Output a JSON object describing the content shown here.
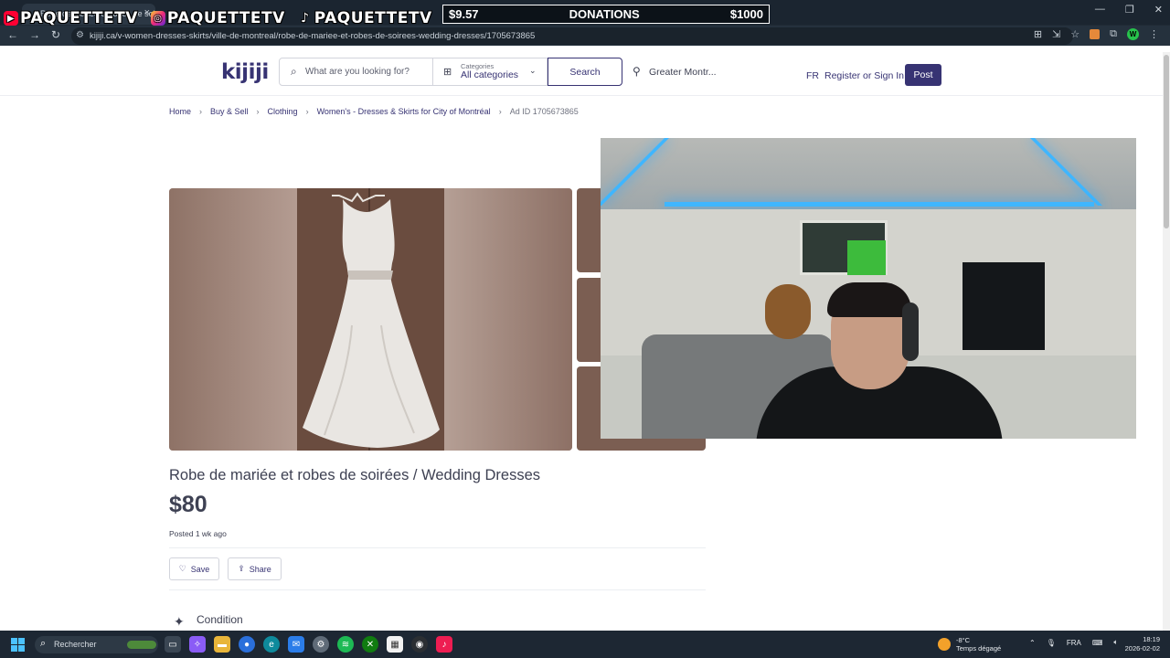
{
  "browser": {
    "tab_title": "Robe de mariée et robes de soi...",
    "url": "kijiji.ca/v-women-dresses-skirts/ville-de-montreal/robe-de-mariee-et-robes-de-soirees-wedding-dresses/1705673865"
  },
  "overlay": {
    "socials": [
      {
        "platform": "youtube",
        "handle": "PAQUETTETV"
      },
      {
        "platform": "instagram",
        "handle": "PAQUETTETV"
      },
      {
        "platform": "tiktok",
        "handle": "PAQUETTETV"
      }
    ],
    "donations": {
      "current": "$9.57",
      "label": "DONATIONS",
      "goal": "$1000"
    }
  },
  "header": {
    "logo": "kijiji",
    "search_placeholder": "What are you looking for?",
    "categories_label": "Categories",
    "categories_value": "All categories",
    "search_button": "Search",
    "location": "Greater Montr...",
    "lang_link": "FR",
    "register_link": "Register or Sign In",
    "post_button": "Post"
  },
  "breadcrumb": [
    "Home",
    "Buy & Sell",
    "Clothing",
    "Women's - Dresses & Skirts for City of Montréal",
    "Ad ID 1705673865"
  ],
  "listing": {
    "title": "Robe de mariée et robes de soirées / Wedding Dresses",
    "price": "$80",
    "posted": "Posted 1 wk ago",
    "save_button": "Save",
    "share_button": "Share",
    "section_condition": "Condition"
  },
  "taskbar": {
    "search_placeholder": "Rechercher",
    "weather_temp": "-8°C",
    "weather_desc": "Temps dégagé",
    "language": "FRA",
    "time": "18:19",
    "date": "2026-02-02"
  },
  "colors": {
    "brand": "#373373",
    "text": "#3e4153",
    "taskbar": "#1d2733"
  }
}
